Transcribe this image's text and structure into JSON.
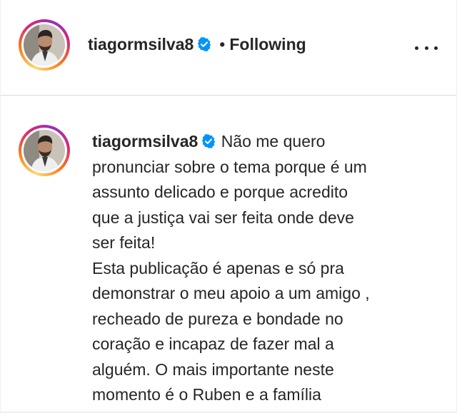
{
  "post_header": {
    "username": "tiagormsilva8",
    "separator": "•",
    "follow_state": "Following"
  },
  "caption": {
    "username": "tiagormsilva8",
    "lines": [
      "Não me quero",
      "pronunciar sobre o tema porque é um",
      "assunto delicado e porque acredito",
      "que a justiça vai ser feita onde deve",
      "ser feita!",
      "Esta publicação é apenas e só pra",
      "demonstrar o meu apoio a um amigo ,",
      "recheado de pureza e bondade no",
      "coração e incapaz de fazer mal a",
      "alguém. O mais importante neste",
      "momento é o Ruben e a família"
    ]
  },
  "colors": {
    "text": "#262626",
    "verified_badge": "#0095f6",
    "divider": "#dbdbdb"
  },
  "icons": {
    "verified": "verified-badge-icon",
    "more": "more-options-icon"
  }
}
